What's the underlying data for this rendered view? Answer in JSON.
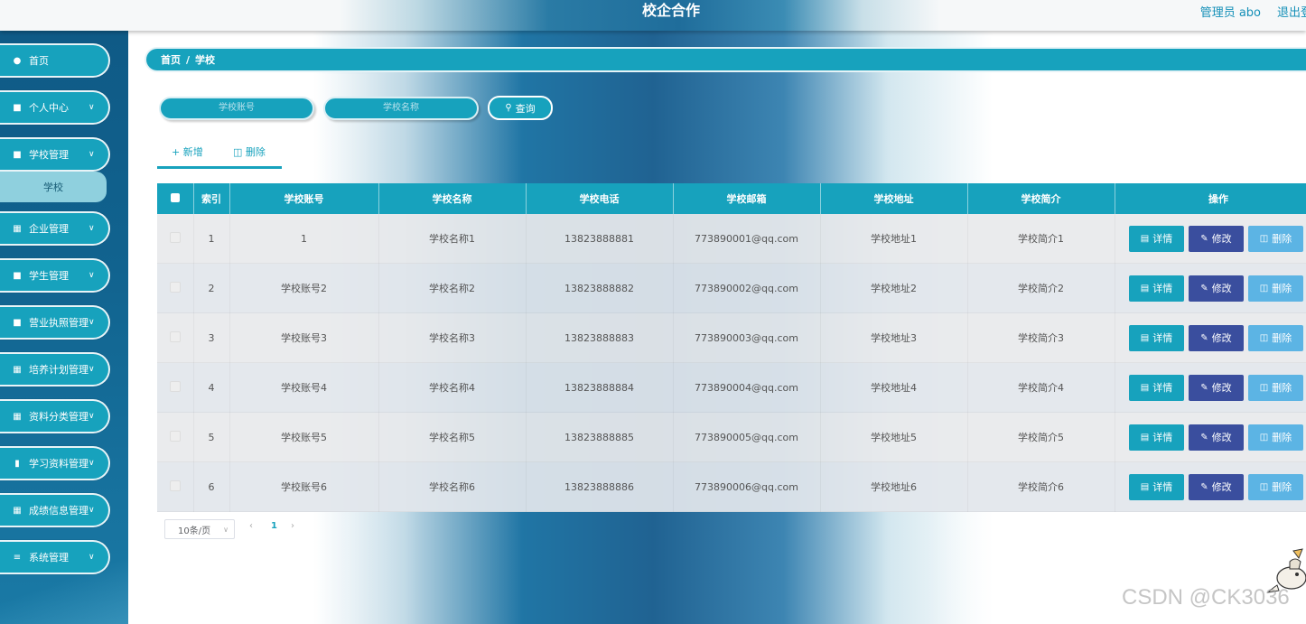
{
  "header": {
    "title": "校企合作",
    "user": "管理员 abo",
    "logout": "退出登录"
  },
  "sidebar": {
    "items": [
      {
        "label": "首页",
        "icon": "home-icon"
      },
      {
        "label": "个人中心",
        "icon": "user-icon"
      },
      {
        "label": "学校管理",
        "icon": "school-icon"
      },
      {
        "label": "企业管理",
        "icon": "grid-icon"
      },
      {
        "label": "学生管理",
        "icon": "student-icon"
      },
      {
        "label": "营业执照管理",
        "icon": "license-icon"
      },
      {
        "label": "培养计划管理",
        "icon": "grid-icon"
      },
      {
        "label": "资料分类管理",
        "icon": "grid-icon"
      },
      {
        "label": "学习资料管理",
        "icon": "book-icon"
      },
      {
        "label": "成绩信息管理",
        "icon": "grid-icon"
      },
      {
        "label": "系统管理",
        "icon": "sliders-icon"
      }
    ],
    "active_submenu": "学校"
  },
  "breadcrumb": {
    "home": "首页",
    "separator": "/",
    "current": "学校"
  },
  "search": {
    "account_placeholder": "学校账号",
    "name_placeholder": "学校名称",
    "button": "查询"
  },
  "toolbar": {
    "add": "新增",
    "delete": "删除"
  },
  "table": {
    "columns": [
      "索引",
      "学校账号",
      "学校名称",
      "学校电话",
      "学校邮箱",
      "学校地址",
      "学校简介",
      "操作"
    ],
    "rows": [
      {
        "index": "1",
        "account": "1",
        "name": "学校名称1",
        "phone": "13823888881",
        "email": "773890001@qq.com",
        "address": "学校地址1",
        "intro": "学校简介1"
      },
      {
        "index": "2",
        "account": "学校账号2",
        "name": "学校名称2",
        "phone": "13823888882",
        "email": "773890002@qq.com",
        "address": "学校地址2",
        "intro": "学校简介2"
      },
      {
        "index": "3",
        "account": "学校账号3",
        "name": "学校名称3",
        "phone": "13823888883",
        "email": "773890003@qq.com",
        "address": "学校地址3",
        "intro": "学校简介3"
      },
      {
        "index": "4",
        "account": "学校账号4",
        "name": "学校名称4",
        "phone": "13823888884",
        "email": "773890004@qq.com",
        "address": "学校地址4",
        "intro": "学校简介4"
      },
      {
        "index": "5",
        "account": "学校账号5",
        "name": "学校名称5",
        "phone": "13823888885",
        "email": "773890005@qq.com",
        "address": "学校地址5",
        "intro": "学校简介5"
      },
      {
        "index": "6",
        "account": "学校账号6",
        "name": "学校名称6",
        "phone": "13823888886",
        "email": "773890006@qq.com",
        "address": "学校地址6",
        "intro": "学校简介6"
      }
    ],
    "actions": {
      "detail": "详情",
      "edit": "修改",
      "delete": "删除"
    }
  },
  "pagination": {
    "page_size": "10条/页",
    "current_page": "1"
  },
  "watermark": "CSDN @CK3036",
  "colors": {
    "accent": "#17a2bd",
    "edit": "#3a4e9e",
    "delete": "#5cb4e4",
    "sidebar": "#11638f"
  }
}
